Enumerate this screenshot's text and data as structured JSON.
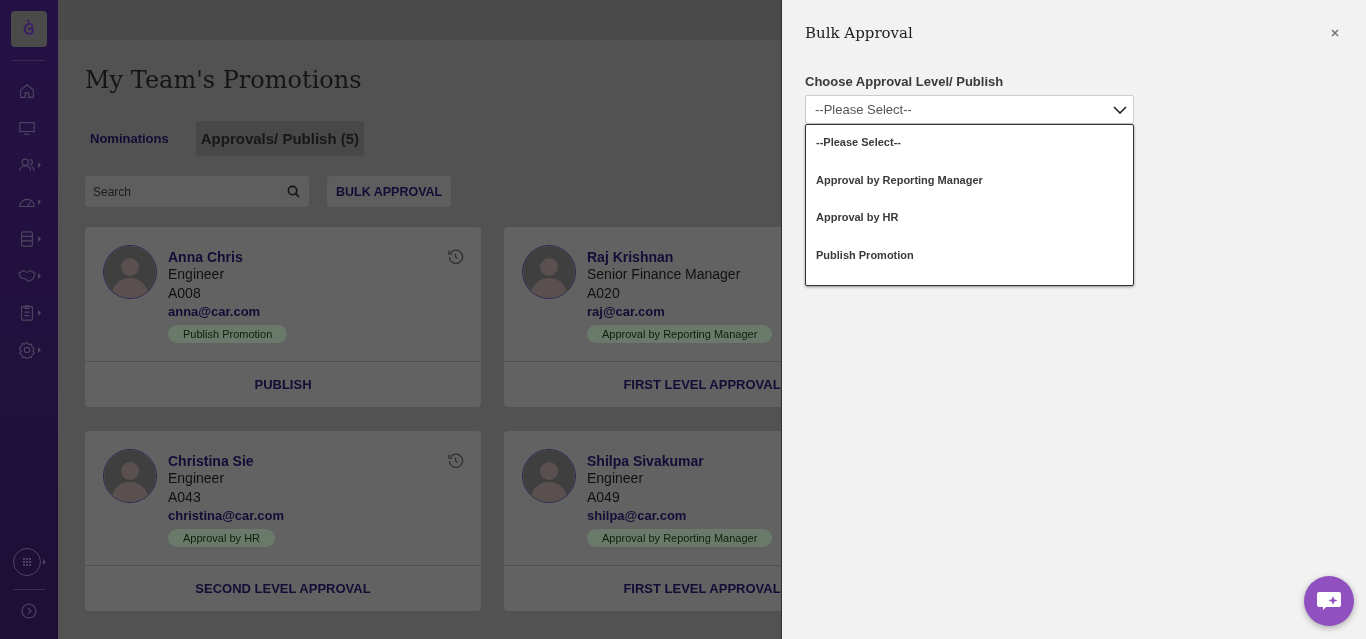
{
  "page": {
    "title": "My Team's Promotions"
  },
  "tabs": [
    {
      "label": "Nominations",
      "selected": false
    },
    {
      "label": "Approvals/ Publish (5)",
      "selected": true
    }
  ],
  "search": {
    "placeholder": "Search"
  },
  "bulk_button": "BULK APPROVAL",
  "cards": [
    {
      "name": "Anna Chris",
      "role": "Engineer",
      "id": "A008",
      "email": "anna@car.com",
      "status": "Publish Promotion",
      "action": "PUBLISH",
      "history": true
    },
    {
      "name": "Raj Krishnan",
      "role": "Senior Finance Manager",
      "id": "A020",
      "email": "raj@car.com",
      "status": "Approval by Reporting Manager",
      "action": "FIRST LEVEL APPROVAL",
      "history": false
    },
    {
      "name": "Christina Sie",
      "role": "Engineer",
      "id": "A043",
      "email": "christina@car.com",
      "status": "Approval by HR",
      "action": "SECOND LEVEL APPROVAL",
      "history": true
    },
    {
      "name": "Shilpa Sivakumar",
      "role": "Engineer",
      "id": "A049",
      "email": "shilpa@car.com",
      "status": "Approval by Reporting Manager",
      "action": "FIRST LEVEL APPROVAL",
      "history": false
    }
  ],
  "panel": {
    "title": "Bulk Approval",
    "field_label": "Choose Approval Level/ Publish",
    "select_value": "--Please Select--",
    "expanded": true,
    "options": [
      {
        "label": "--Please Select--"
      },
      {
        "label": "Approval by Reporting Manager"
      },
      {
        "label": "Approval by HR"
      },
      {
        "label": "Publish Promotion"
      }
    ]
  }
}
